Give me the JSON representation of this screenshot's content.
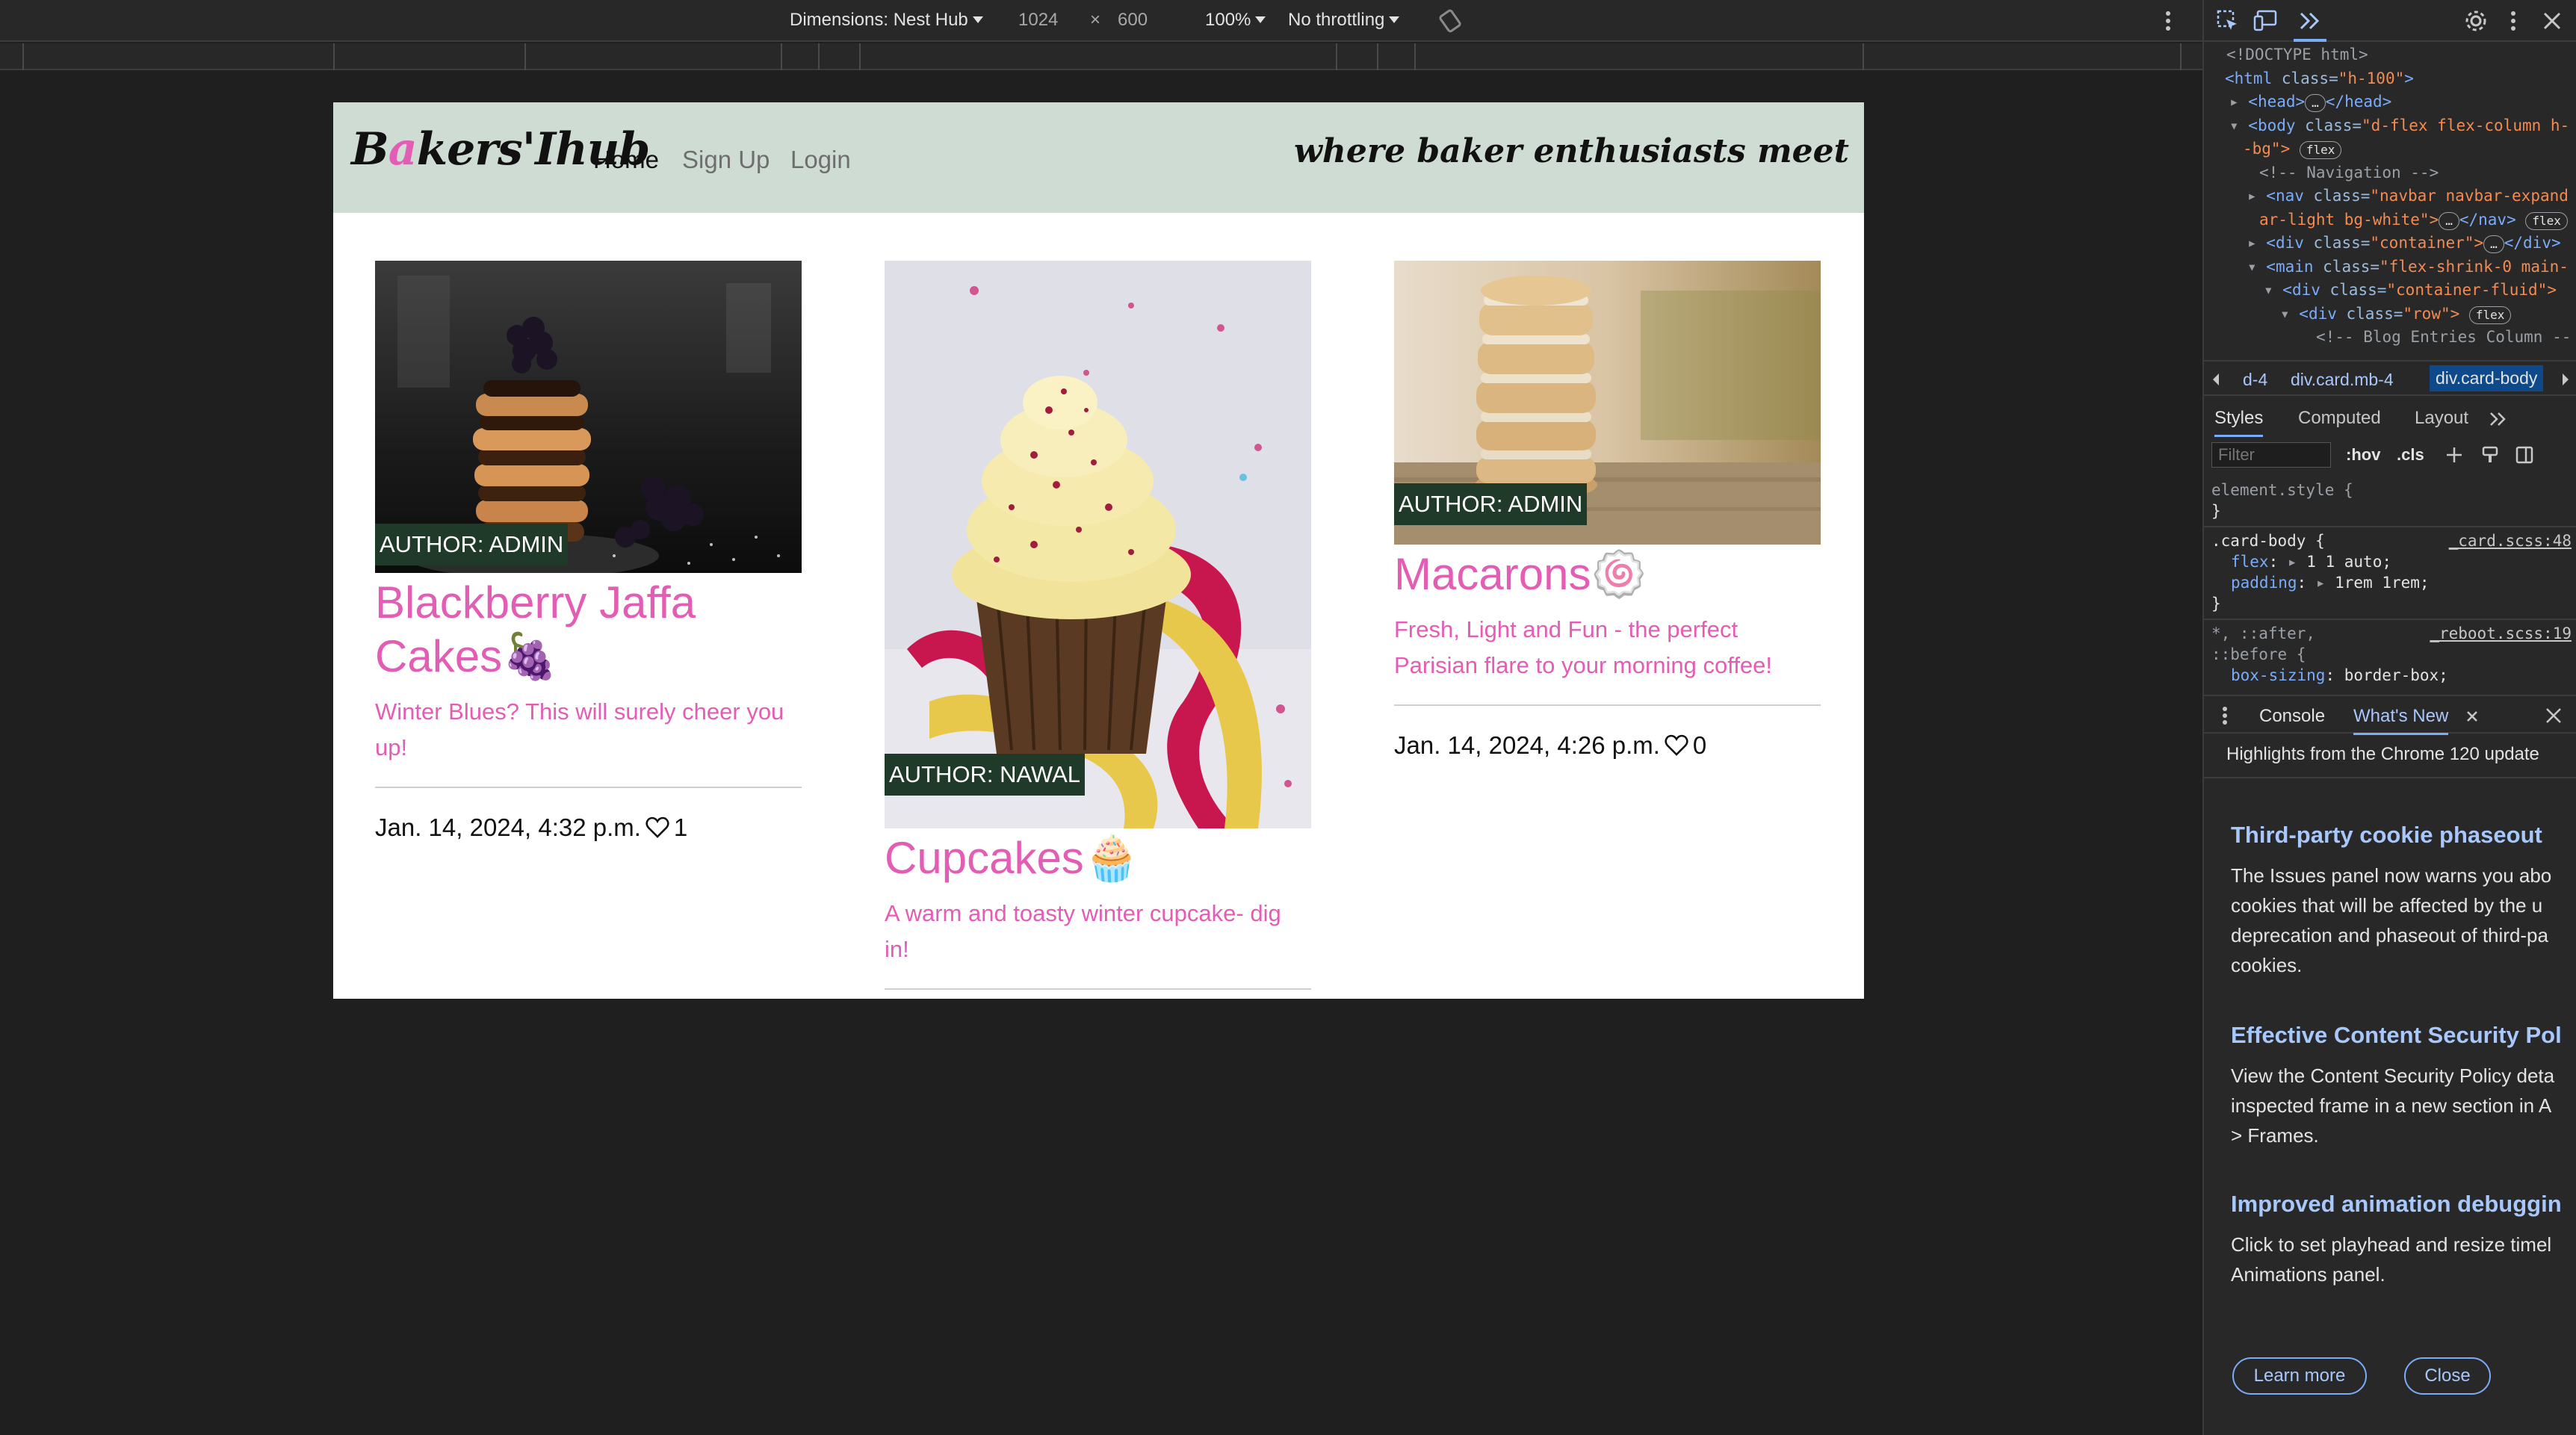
{
  "toolbar": {
    "dimensions_label": "Dimensions: Nest Hub",
    "width": "1024",
    "times": "×",
    "height": "600",
    "zoom": "100%",
    "throttling": "No throttling"
  },
  "page": {
    "brand_first": "B",
    "brand_accent": "a",
    "brand_rest": "kers'Ihub",
    "nav": [
      "Home",
      "Sign Up",
      "Login"
    ],
    "tagline": "where baker enthusiasts meet",
    "accent_color": "#e35db5",
    "navbar_color": "#cfdcd3",
    "posts": [
      {
        "author": "AUTHOR: ADMIN",
        "title": "Blackberry Jaffa Cakes🍇",
        "description": "Winter Blues? This will surely cheer you up!",
        "date": "Jan. 14, 2024, 4:32 p.m.",
        "likes": "1"
      },
      {
        "author": "AUTHOR: NAWAL",
        "title": "Cupcakes🧁",
        "description": "A warm and toasty winter cupcake- dig in!",
        "date": "",
        "likes": ""
      },
      {
        "author": "AUTHOR: ADMIN",
        "title": "Macarons🍥",
        "description": "Fresh, Light and Fun - the perfect Parisian flare to your morning coffee!",
        "date": "Jan. 14, 2024, 4:26 p.m.",
        "likes": "0"
      }
    ]
  },
  "devtools": {
    "dom": {
      "doctype": "<!DOCTYPE html>",
      "html_tag": "<html",
      "html_attr": " class=",
      "html_val": "\"h-100\"",
      "head": "<head>",
      "head_close": "</head>",
      "body_tag": "<body",
      "body_attr": " class=",
      "body_val": "\"d-flex flex-column h-",
      "body_val2": "-bg\">",
      "flex": "flex",
      "comment_nav": "<!-- Navigation -->",
      "nav_tag": "<nav",
      "nav_val": "\"navbar navbar-expand",
      "nav_val2": "ar-light bg-white\">",
      "nav_close": "</nav>",
      "container_tag": "<div",
      "container_val": "\"container\">",
      "div_close": "</div>",
      "main_tag": "<main",
      "main_val": "\"flex-shrink-0 main-",
      "fluid_val": "\"container-fluid\">",
      "row_val": "\"row\">",
      "comment_blog": "<!-- Blog Entries Column --"
    },
    "breadcrumbs": [
      "d-4",
      "div.card.mb-4",
      "div.card-body"
    ],
    "tabs": [
      "Styles",
      "Computed",
      "Layout"
    ],
    "filter_placeholder": "Filter",
    "hov": ":hov",
    "cls": ".cls",
    "styles": {
      "element_style": "element.style {",
      "close_brace": "}",
      "card_body_selector": ".card-body {",
      "card_body_source": "_card.scss:48",
      "flex_prop": "flex",
      "flex_val": "1 1 auto;",
      "padding_prop": "padding",
      "padding_val": "1rem 1rem;",
      "reboot_selector": "*, ::after,",
      "reboot_selector2": "::before {",
      "reboot_source": "_reboot.scss:19",
      "box_sizing_prop": "box-sizing",
      "box_sizing_val": "border-box;"
    },
    "drawer_tabs": [
      "Console",
      "What's New"
    ],
    "whats_new": {
      "intro": "Highlights from the Chrome 120 update",
      "sections": [
        {
          "title": "Third-party cookie phaseout",
          "lines": [
            "The Issues panel now warns you abo",
            "cookies that will be affected by the u",
            "deprecation and phaseout of third-pa",
            "cookies."
          ]
        },
        {
          "title": "Effective Content Security Pol",
          "lines": [
            "View the Content Security Policy deta",
            "inspected frame in a new section in A",
            "> Frames."
          ]
        },
        {
          "title": "Improved animation debuggin",
          "lines": [
            "Click to set playhead and resize timel",
            "Animations panel."
          ]
        }
      ],
      "learn_more": "Learn more",
      "close": "Close"
    }
  }
}
